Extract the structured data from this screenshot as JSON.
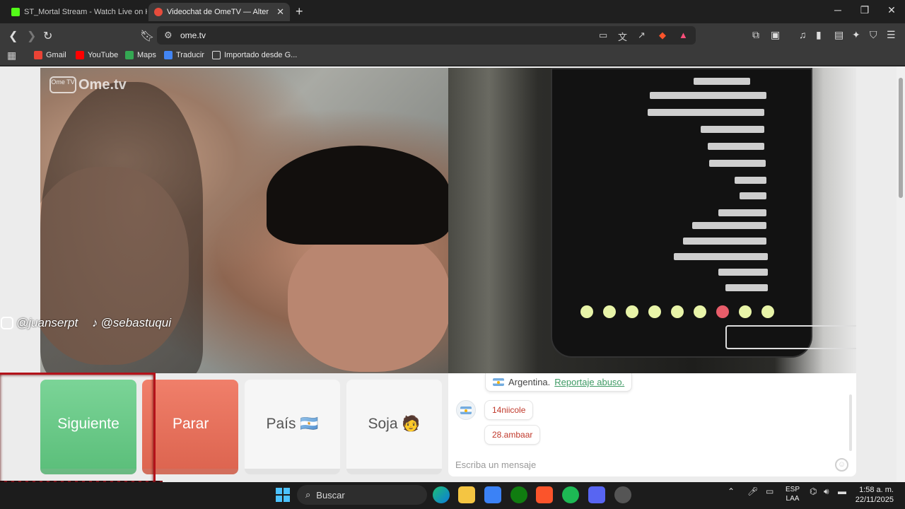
{
  "browser": {
    "tabs": [
      {
        "label": "ST_Mortal Stream - Watch Live on Ki",
        "active": false,
        "favicon_color": "#53fc18"
      },
      {
        "label": "Videochat de OmeTV — Alter",
        "active": true,
        "favicon_color": "#e74c3c"
      }
    ],
    "address": "ome.tv",
    "bookmarks": [
      {
        "label": "Gmail",
        "icon": "gmail-icon",
        "color": "#ea4335"
      },
      {
        "label": "YouTube",
        "icon": "youtube-icon",
        "color": "#ff0000"
      },
      {
        "label": "Maps",
        "icon": "maps-icon",
        "color": "#34a853"
      },
      {
        "label": "Traducir",
        "icon": "translate-icon",
        "color": "#4285f4"
      },
      {
        "label": "Importado desde G...",
        "icon": "folder-icon",
        "color": "#dddddd"
      }
    ]
  },
  "page": {
    "logo": {
      "tv": "Ome TV",
      "text": "Ome.tv"
    },
    "overlay_social": [
      {
        "icon": "instagram-icon",
        "handle": "@juanserpt"
      },
      {
        "icon": "tiktok-icon",
        "handle": "@sebastuqui"
      }
    ],
    "buttons": {
      "next": "Siguiente",
      "stop": "Parar",
      "country": "País 🇦🇷",
      "gender": "Soja 🧑"
    },
    "chat": {
      "country_line": "Argentina.",
      "report_link": "Reportaje abuso.",
      "messages": [
        "14niicole",
        "28.ambaar"
      ],
      "placeholder": "Escriba un mensaje"
    }
  },
  "taskbar": {
    "search_label": "Buscar",
    "language": [
      "ESP",
      "LAA"
    ],
    "time": "1:58 a. m.",
    "date": "22/11/2025"
  },
  "colors": {
    "next": "#5cbf7b",
    "stop": "#dd6550",
    "link": "#3e9a64",
    "message": "#c0392b"
  }
}
